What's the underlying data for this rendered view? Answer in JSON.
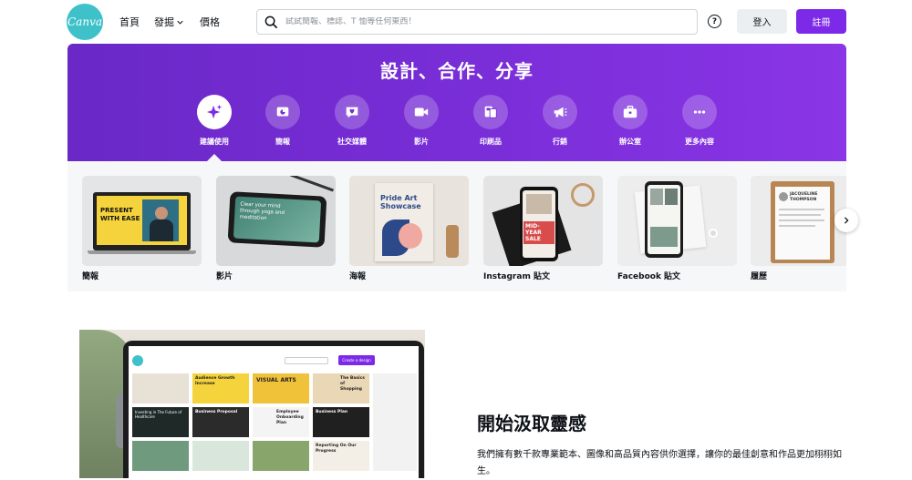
{
  "nav": {
    "logo_text": "Canva",
    "home": "首頁",
    "discover": "發掘",
    "pricing": "價格",
    "search_placeholder": "試試簡報、標誌、T 恤等任何東西！",
    "help": "?",
    "login": "登入",
    "signup": "註冊"
  },
  "hero": {
    "title": "設計、合作、分享",
    "categories": [
      {
        "label": "建議使用",
        "icon": "sparkle-icon",
        "active": true
      },
      {
        "label": "簡報",
        "icon": "presentation-icon"
      },
      {
        "label": "社交媒體",
        "icon": "heart-chat-icon"
      },
      {
        "label": "影片",
        "icon": "video-camera-icon"
      },
      {
        "label": "印刷品",
        "icon": "print-icon"
      },
      {
        "label": "行銷",
        "icon": "megaphone-icon"
      },
      {
        "label": "辦公室",
        "icon": "briefcase-icon"
      },
      {
        "label": "更多內容",
        "icon": "more-dots-icon"
      }
    ]
  },
  "carousel": {
    "cards": [
      {
        "label": "簡報",
        "thumb_text": "PRESENT WITH EASE"
      },
      {
        "label": "影片",
        "thumb_text": "Clear your mind through yoga and meditation"
      },
      {
        "label": "海報",
        "thumb_text": "Pride Art Showcase"
      },
      {
        "label": "Instagram 貼文",
        "thumb_text": "MID-YEAR SALE"
      },
      {
        "label": "Facebook 貼文",
        "thumb_text": ""
      },
      {
        "label": "履歷",
        "thumb_text": "JACQUELINE THOMPSON"
      }
    ]
  },
  "promo": {
    "title": "開始汲取靈感",
    "text": "我們擁有數千款專業範本、圖像和高品質內容供你選擇，讓你的最佳創意和作品更加栩栩如生。",
    "screen_tiles": [
      "Audience Growth Increase",
      "VISUAL ARTS",
      "The Basics of Shopping",
      "Investing in The Future of Healthcare",
      "Business Proposal",
      "Employee Onboarding Plan",
      "Business Plan",
      "Reporting On Our Progress"
    ],
    "screen_button": "Create a design"
  },
  "colors": {
    "brand_purple": "#7d2ae8",
    "canva_teal": "#3fc1c9"
  }
}
